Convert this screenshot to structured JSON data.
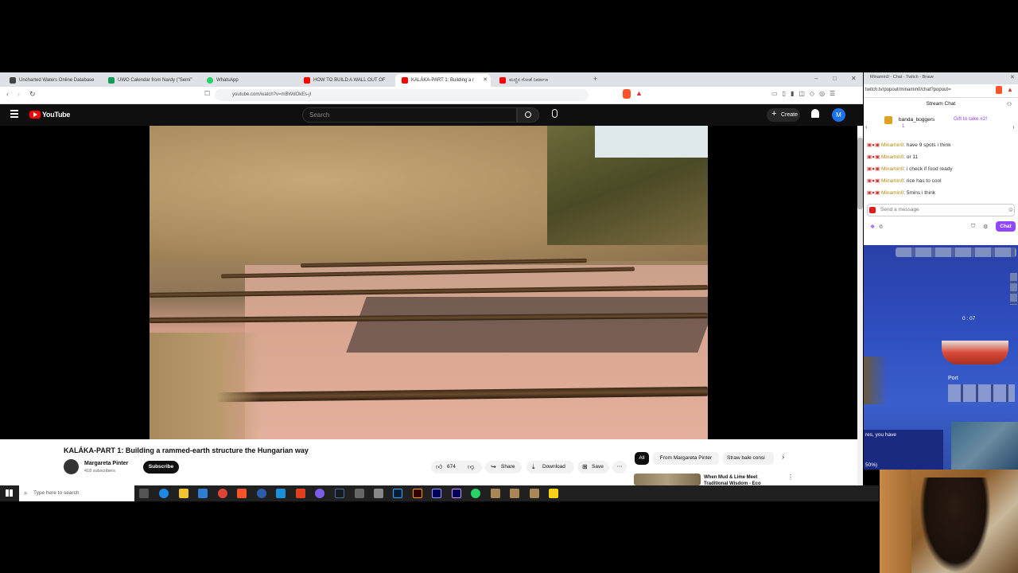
{
  "browser": {
    "tabs": [
      {
        "label": "Uncharted Waters Online Database",
        "color": "#444444"
      },
      {
        "label": "UWO Calendar from Nardy (\"Semi\"",
        "color": "#0f9d58"
      },
      {
        "label": "WhatsApp",
        "color": "#25d366"
      },
      {
        "label": "HOW TO BUILD A WALL OUT OF",
        "color": "#ff0000"
      },
      {
        "label": "KALÁKA-PART 1: Building a r",
        "color": "#ff0000"
      },
      {
        "label": "ಮಣ್ಣಿನ ಗೋಡೆ ನಿರ್ಮಾಣ",
        "color": "#ff0000"
      }
    ],
    "url": "youtube.com/watch?v=mBWdOkEs-jI"
  },
  "youtube": {
    "logo": "YouTube",
    "search_placeholder": "Search",
    "create_label": "Create",
    "avatar_letter": "M",
    "video_title": "KALÁKA-PART 1: Building a rammed-earth structure the Hungarian way",
    "channel_name": "Margareta Pinter",
    "subscribers": "418 subscribers",
    "subscribe_label": "Subscribe",
    "likes": "674",
    "share_label": "Share",
    "download_label": "Download",
    "save_label": "Save",
    "chips": [
      "All",
      "From Margareta Pinter",
      "Straw bale consi"
    ],
    "rec_title": "When Mud & Lime Meet Traditional Wisdom - Eco"
  },
  "side": {
    "window_title": "Minamin0 - Chat - Twitch - Brave",
    "url": "twitch.tv/popout/minamin0/chat?popout=",
    "stream_chat": "Stream Chat",
    "gift_user": "banda_boggers",
    "gift_count": "1",
    "gift_text": "Gift to take #2!",
    "messages": [
      {
        "user": "Minamin0",
        "text": "have 9 spots i think"
      },
      {
        "user": "Minamin0",
        "text": "or 11"
      },
      {
        "user": "Minamin0",
        "text": "i check if food ready"
      },
      {
        "user": "Minamin0",
        "text": "rice has to cool"
      },
      {
        "user": "Minamin0",
        "text": "5mins i think"
      }
    ],
    "send_placeholder": "Send a message",
    "points": "0",
    "chat_button": "Chat",
    "game_port": "Port",
    "game_ship_label": "0 : 07",
    "game_text": "res, you have",
    "game_pct": "50%)"
  },
  "taskbar": {
    "search_placeholder": "Type here to search"
  }
}
